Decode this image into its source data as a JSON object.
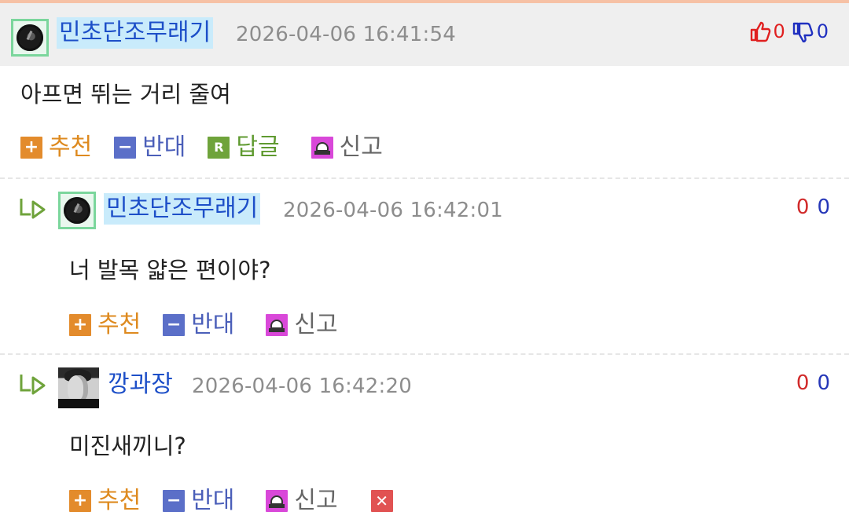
{
  "comments": [
    {
      "nickname": "민초단조무래기",
      "timestamp": "2026-04-06 16:41:54",
      "text": "아프면 뛰는 거리 줄여",
      "up_count": "0",
      "down_count": "0",
      "actions": {
        "recommend": "추천",
        "oppose": "반대",
        "reply": "답글",
        "report": "신고"
      },
      "icons": {
        "reply_box": "R"
      }
    },
    {
      "nickname": "민초단조무래기",
      "timestamp": "2026-04-06 16:42:01",
      "text": "너 발목 얇은 편이야?",
      "up_count": "0",
      "down_count": "0",
      "actions": {
        "recommend": "추천",
        "oppose": "반대",
        "report": "신고"
      }
    },
    {
      "nickname": "깡과장",
      "timestamp": "2026-04-06 16:42:20",
      "text": "미진새끼니?",
      "up_count": "0",
      "down_count": "0",
      "actions": {
        "recommend": "추천",
        "oppose": "반대",
        "report": "신고"
      }
    }
  ],
  "colors": {
    "header_bg": "#efefef",
    "nickname": "#1d4fc8",
    "recommend": "#de8a1f",
    "oppose": "#4b5fb9",
    "reply": "#5f9a30",
    "up_count": "#d12a2a",
    "down_count": "#2637b8"
  }
}
